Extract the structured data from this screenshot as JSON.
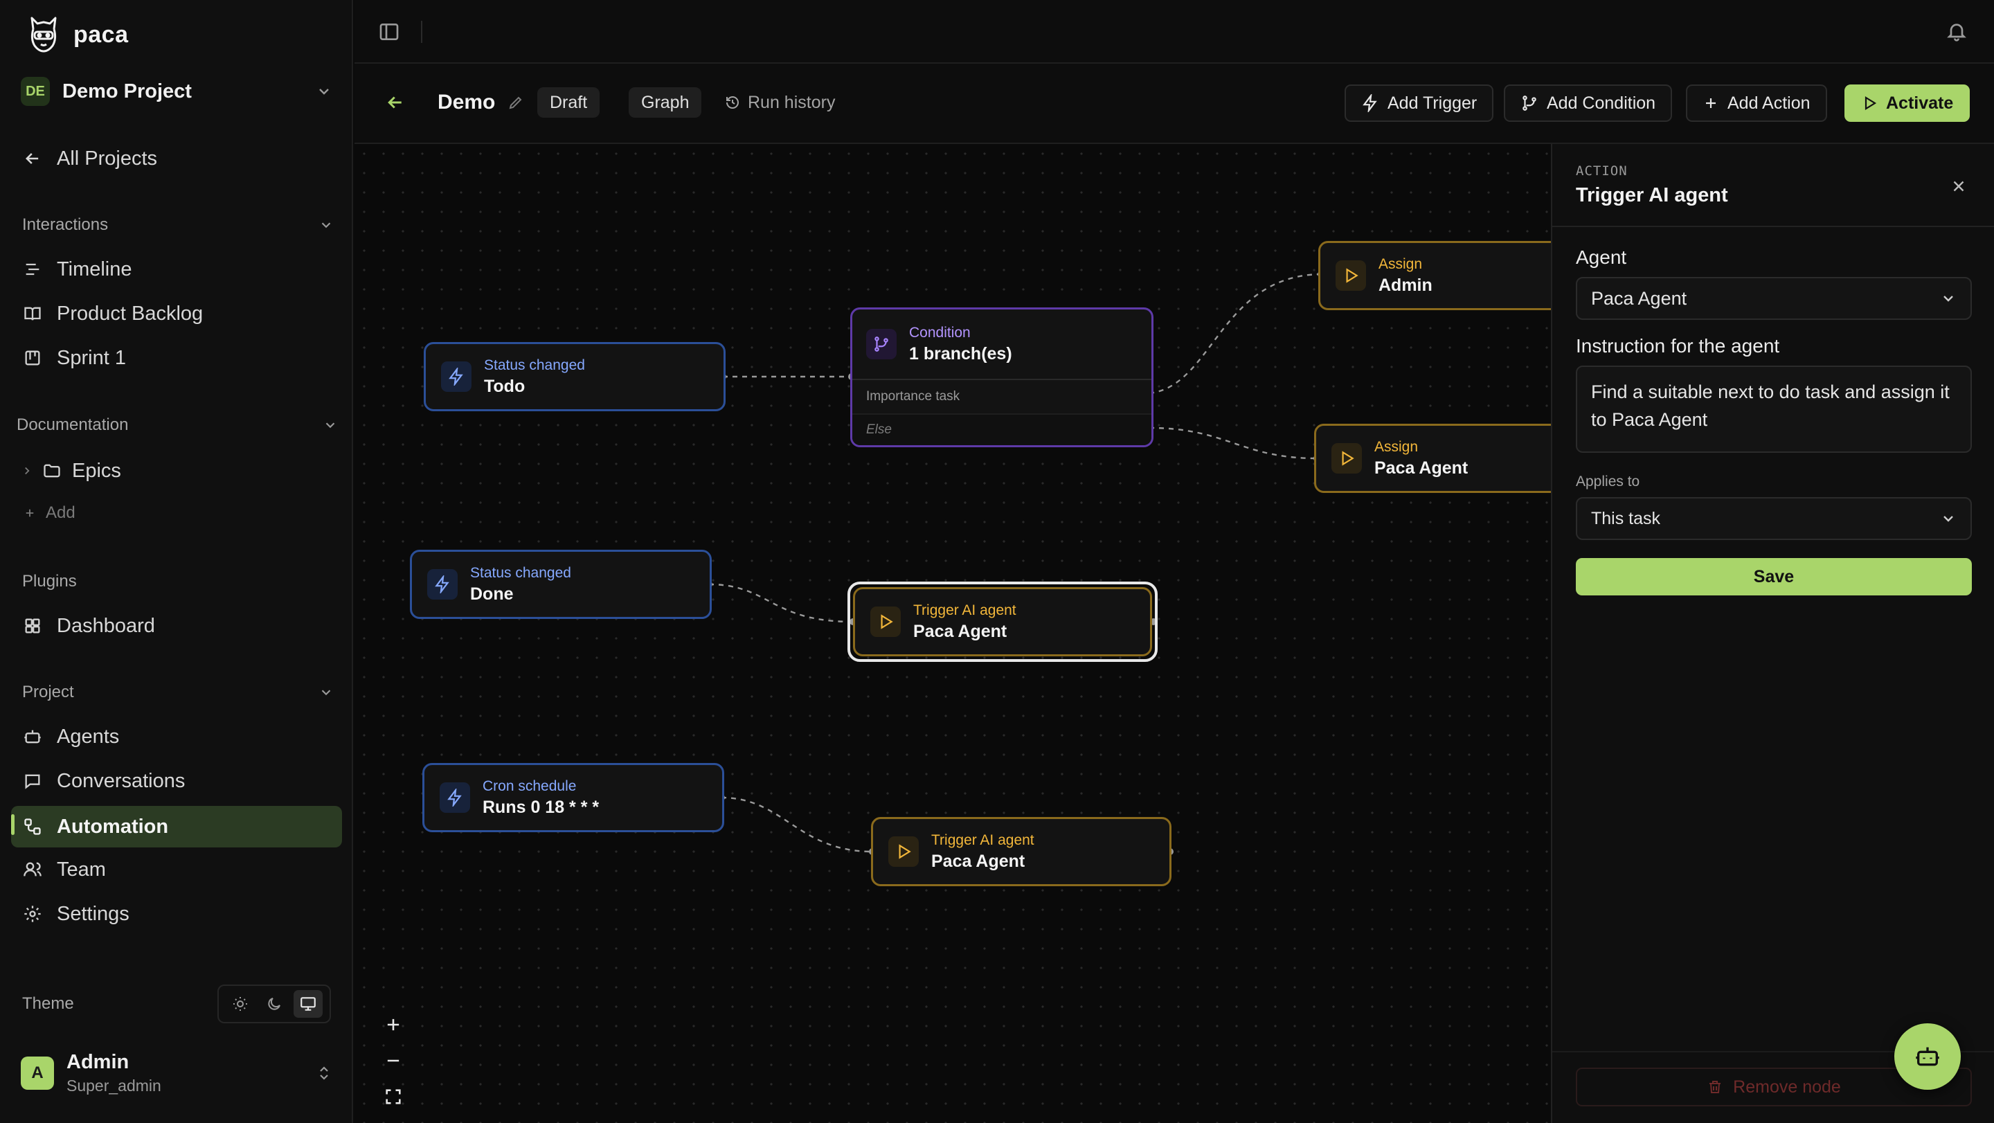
{
  "app": {
    "name": "paca"
  },
  "sidebar": {
    "project_badge": "DE",
    "project_name": "Demo Project",
    "all_projects": "All Projects",
    "sections": {
      "interactions": "Interactions",
      "documentation": "Documentation",
      "plugins": "Plugins",
      "project": "Project"
    },
    "interactions_items": [
      "Timeline",
      "Product Backlog",
      "Sprint 1"
    ],
    "documentation_items": {
      "epics": "Epics",
      "add": "Add"
    },
    "plugins_items": [
      "Dashboard"
    ],
    "project_items": [
      "Agents",
      "Conversations",
      "Automation",
      "Team",
      "Settings"
    ],
    "theme_label": "Theme",
    "user": {
      "initial": "A",
      "name": "Admin",
      "role": "Super_admin"
    }
  },
  "toolbar": {
    "title": "Demo",
    "status": "Draft",
    "view_graph": "Graph",
    "run_history": "Run history",
    "add_trigger": "Add Trigger",
    "add_condition": "Add Condition",
    "add_action": "Add Action",
    "activate": "Activate"
  },
  "canvas": {
    "nodes": {
      "t1": {
        "label": "Status changed",
        "value": "Todo"
      },
      "t2": {
        "label": "Status changed",
        "value": "Done"
      },
      "t3": {
        "label": "Cron schedule",
        "value": "Runs 0 18 * * *"
      },
      "cond": {
        "label": "Condition",
        "value": "1 branch(es)",
        "branch": "Importance task",
        "else": "Else"
      },
      "a1": {
        "label": "Assign",
        "value": "Admin"
      },
      "a2": {
        "label": "Assign",
        "value": "Paca Agent"
      },
      "a3": {
        "label": "Trigger AI agent",
        "value": "Paca Agent"
      },
      "a4": {
        "label": "Trigger AI agent",
        "value": "Paca Agent"
      }
    }
  },
  "panel": {
    "kicker": "ACTION",
    "title": "Trigger AI agent",
    "agent_label": "Agent",
    "agent_value": "Paca Agent",
    "instruction_label": "Instruction for the agent",
    "instruction_value": "Find a suitable next to do task and assign it to Paca Agent",
    "applies_label": "Applies to",
    "applies_value": "This task",
    "save": "Save",
    "remove": "Remove node"
  },
  "colors": {
    "accent": "#a9d56a",
    "trigger": "#2b4f98",
    "action": "#8a6a1c",
    "condition": "#5e3aa8"
  }
}
